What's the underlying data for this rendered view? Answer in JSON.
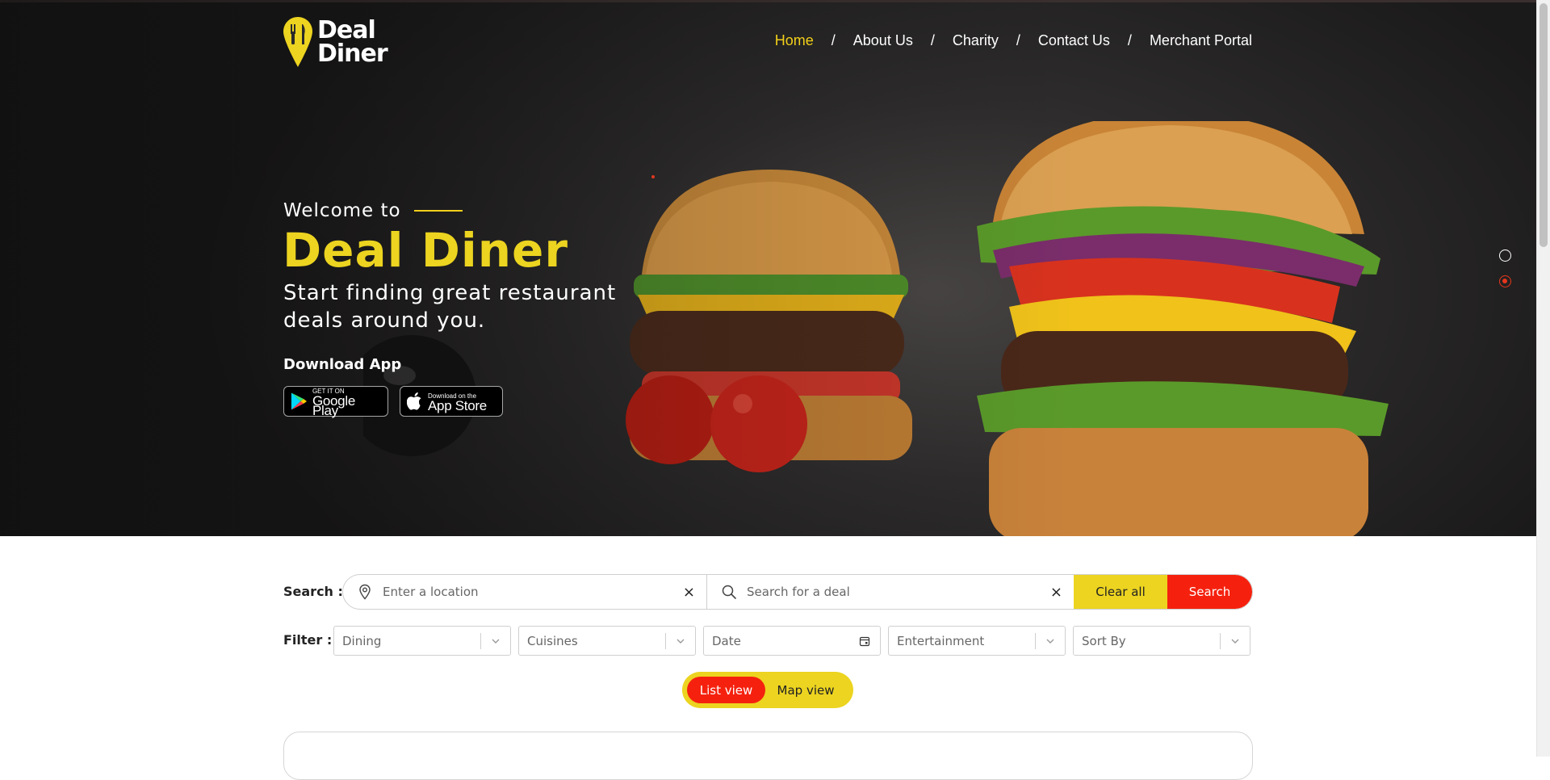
{
  "colors": {
    "accent_yellow": "#ecd420",
    "accent_red": "#f5210e",
    "hero_dark": "#2e2c2c"
  },
  "logo": {
    "line1": "Deal",
    "line2": "Diner",
    "icon": "map-pin-fork-knife-icon"
  },
  "nav": {
    "items": [
      {
        "label": "Home",
        "active": true
      },
      {
        "label": "About Us"
      },
      {
        "label": "Charity"
      },
      {
        "label": "Contact Us"
      },
      {
        "label": "Merchant Portal"
      }
    ],
    "separator": "/"
  },
  "hero": {
    "welcome": "Welcome to",
    "brand": "Deal Diner",
    "tagline": "Start finding great restaurant deals around you.",
    "download_label": "Download App",
    "google_play": {
      "small": "GET IT ON",
      "big": "Google Play",
      "icon": "google-play-icon"
    },
    "app_store": {
      "small": "Download on the",
      "big": "App Store",
      "icon": "apple-icon"
    },
    "slides": {
      "count": 2,
      "active": 2
    }
  },
  "search": {
    "label": "Search :",
    "location_placeholder": "Enter a location",
    "deal_placeholder": "Search for a deal",
    "clear_icon": "×",
    "clear_all_label": "Clear all",
    "search_label": "Search"
  },
  "filter": {
    "label": "Filter :",
    "dining": "Dining",
    "cuisines": "Cuisines",
    "date": "Date",
    "entertainment": "Entertainment",
    "sort_by": "Sort By"
  },
  "view_toggle": {
    "list_label": "List view",
    "map_label": "Map view",
    "active": "list"
  }
}
